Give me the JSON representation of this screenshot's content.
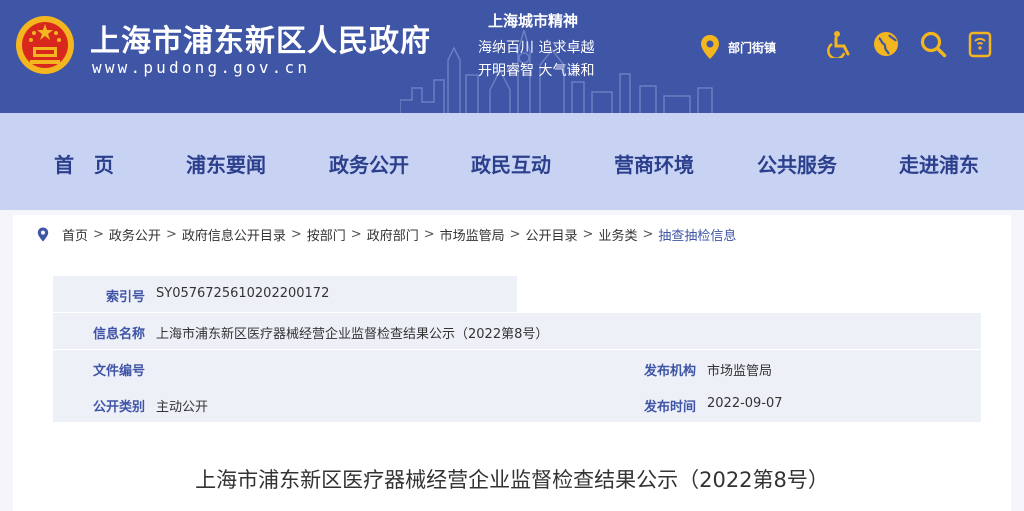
{
  "header": {
    "site_title": "上海市浦东新区人民政府",
    "site_url": "www.pudong.gov.cn",
    "spirit_title": "上海城市精神",
    "spirit_line1": "海纳百川  追求卓越",
    "spirit_line2": "开明睿智  大气谦和",
    "location_label": "部门街镇",
    "icons": [
      "location-pin-icon",
      "accessibility-icon",
      "globe-icon",
      "search-icon",
      "mobile-icon"
    ],
    "colors": {
      "header_bg": "#3f55a6",
      "accent_gold": "#f3b61f"
    }
  },
  "nav": {
    "items": [
      "首　页",
      "浦东要闻",
      "政务公开",
      "政民互动",
      "营商环境",
      "公共服务",
      "走进浦东"
    ]
  },
  "breadcrumb": {
    "items": [
      "首页",
      "政务公开",
      "政府信息公开目录",
      "按部门",
      "政府部门",
      "市场监管局",
      "公开目录",
      "业务类"
    ],
    "current": "抽查抽检信息",
    "separator": ">"
  },
  "info": {
    "index_label": "索引号",
    "index_value": "SY0576725610202200172",
    "name_label": "信息名称",
    "name_value": "上海市浦东新区医疗器械经营企业监督检查结果公示（2022第8号）",
    "docno_label": "文件编号",
    "docno_value": "",
    "issuer_label": "发布机构",
    "issuer_value": "市场监管局",
    "category_label": "公开类别",
    "category_value": "主动公开",
    "date_label": "发布时间",
    "date_value": "2022-09-07"
  },
  "document": {
    "title": "上海市浦东新区医疗器械经营企业监督检查结果公示（2022第8号）"
  }
}
